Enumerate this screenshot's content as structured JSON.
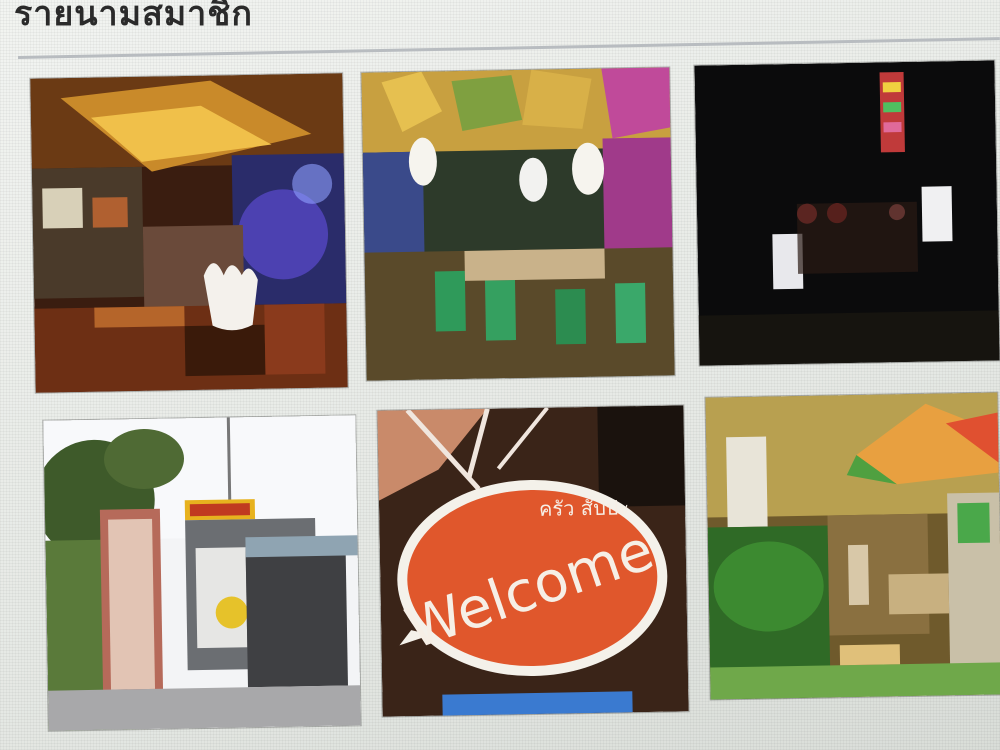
{
  "section": {
    "title": "รายนามสมาชิก"
  },
  "gallery": {
    "photos": [
      {
        "name": "restaurant-interior-photo"
      },
      {
        "name": "colorful-dining-hall-photo"
      },
      {
        "name": "night-exterior-photo"
      },
      {
        "name": "storefront-entrance-photo"
      },
      {
        "name": "welcome-sign-photo",
        "sign_text": "Welcome",
        "sign_thai": "ครัว สัปปะ"
      },
      {
        "name": "garden-seating-photo"
      }
    ]
  },
  "colors": {
    "sign_orange": "#e0572c",
    "dark_tile": "#0b0b0c",
    "rule": "#b8bcc0"
  }
}
